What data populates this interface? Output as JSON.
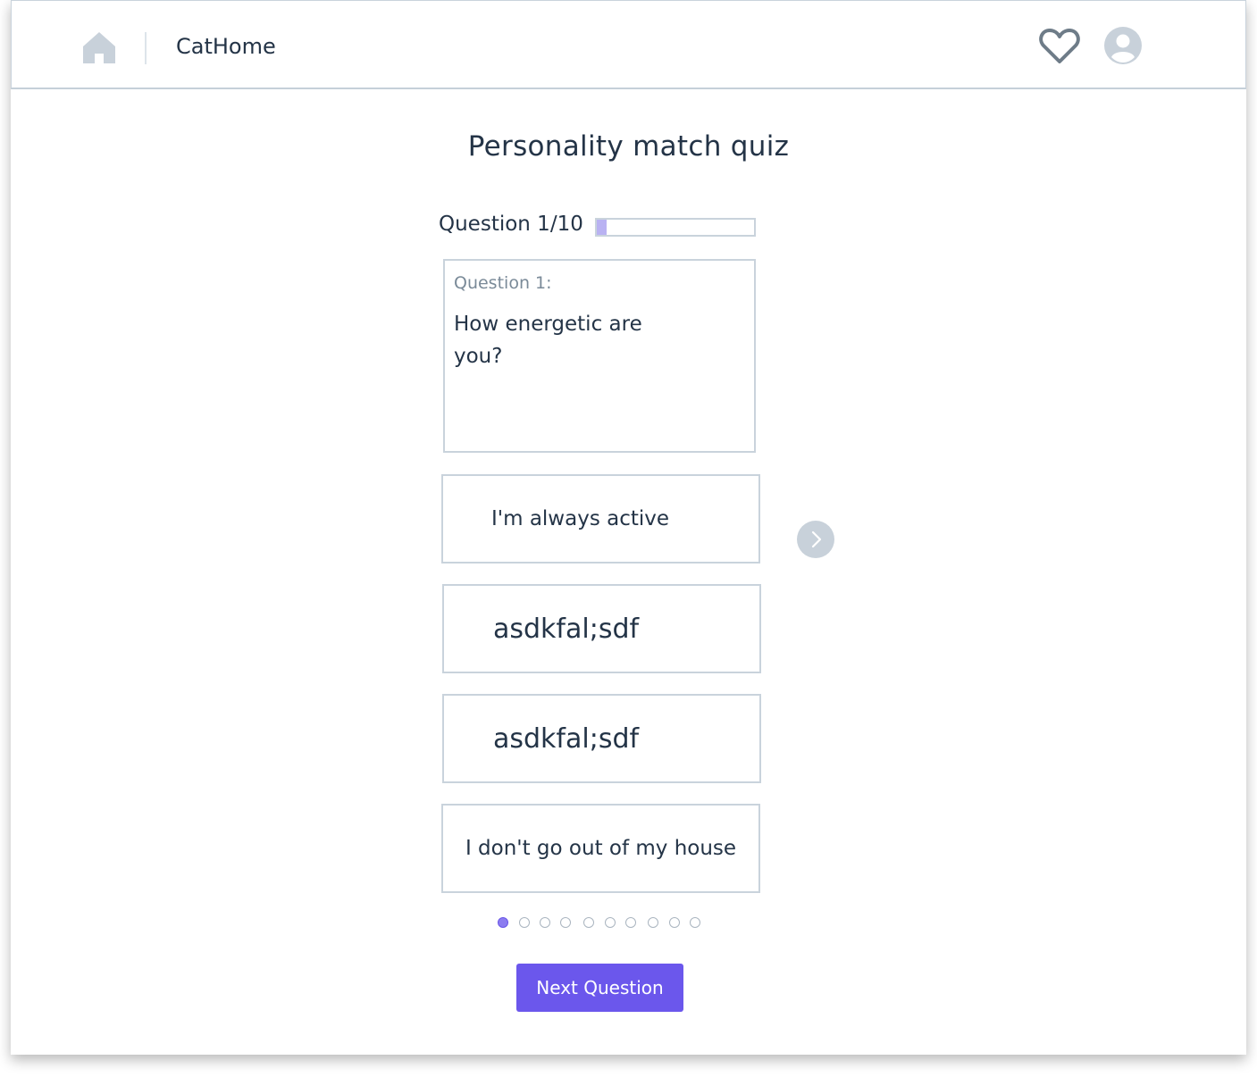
{
  "header": {
    "brand": "CatHome",
    "icons": [
      "home-icon",
      "heart-icon",
      "user-avatar-icon"
    ]
  },
  "quiz": {
    "title": "Personality match quiz",
    "progress_label": "Question 1/10",
    "progress_fraction": 0.06,
    "question_number": "Question 1:",
    "question_text": "How energetic are you?",
    "answers": [
      "I'm always active",
      "asdkfal;sdf",
      "asdkfal;sdf",
      "I don't go out of my house"
    ],
    "page_dots_total": 10,
    "page_dots_active": 1,
    "next_button_label": "Next Question"
  },
  "colors": {
    "accent": "#6b57ec",
    "progress_fill": "#b9b2f2",
    "border": "#c9d3dc",
    "text": "#243447",
    "icon": "#c8d1da"
  }
}
